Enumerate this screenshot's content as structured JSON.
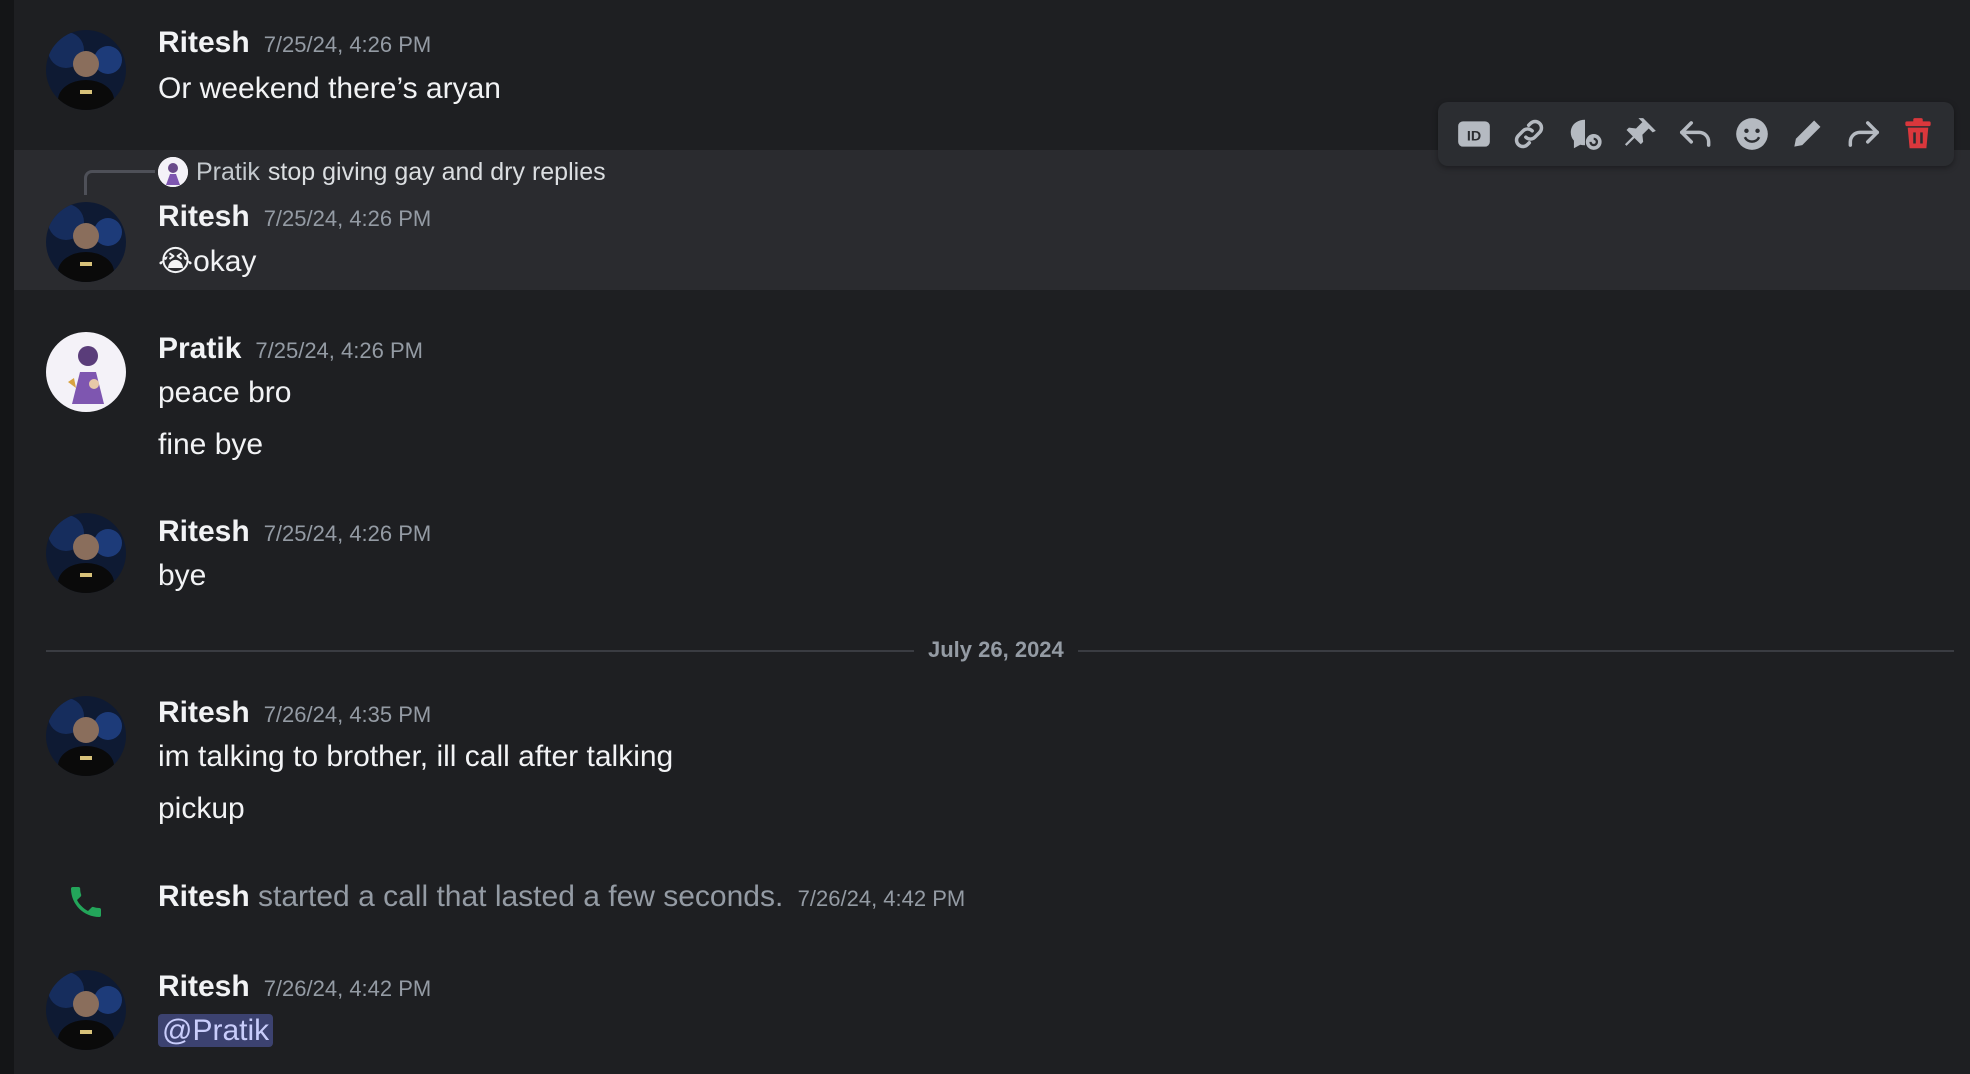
{
  "toolbar": {
    "actions": [
      {
        "icon": "id-icon",
        "label": "Copy ID"
      },
      {
        "icon": "link-icon",
        "label": "Copy Message Link"
      },
      {
        "icon": "thread-icon",
        "label": "Create Thread"
      },
      {
        "icon": "pin-icon",
        "label": "Pin Message"
      },
      {
        "icon": "reply-icon",
        "label": "Reply"
      },
      {
        "icon": "emoji-icon",
        "label": "Add Reaction"
      },
      {
        "icon": "edit-icon",
        "label": "Edit"
      },
      {
        "icon": "forward-icon",
        "label": "Forward"
      },
      {
        "icon": "delete-icon",
        "label": "Delete"
      }
    ],
    "delete_color": "#da373c",
    "icon_color": "#b5bac1"
  },
  "messages": [
    {
      "author": "Ritesh",
      "timestamp": "7/25/24, 4:26 PM",
      "lines": [
        "Or weekend there’s aryan"
      ]
    },
    {
      "author": "Ritesh",
      "timestamp": "7/25/24, 4:26 PM",
      "reply_to": {
        "author": "Pratik",
        "text": "stop giving gay and dry replies"
      },
      "emoji": "😭",
      "lines": [
        "okay"
      ]
    },
    {
      "author": "Pratik",
      "timestamp": "7/25/24, 4:26 PM",
      "lines": [
        "peace bro",
        "fine bye"
      ]
    },
    {
      "author": "Ritesh",
      "timestamp": "7/25/24, 4:26 PM",
      "lines": [
        "bye"
      ]
    },
    {
      "author": "Ritesh",
      "timestamp": "7/26/24, 4:35 PM",
      "lines": [
        "im talking to brother, ill call after talking",
        "pickup"
      ]
    },
    {
      "author": "Ritesh",
      "timestamp": "7/26/24, 4:42 PM",
      "mention": "@Pratik"
    }
  ],
  "date_divider": "July 26, 2024",
  "call": {
    "author": "Ritesh",
    "text": "started a call that lasted a few seconds.",
    "timestamp": "7/26/24, 4:42 PM",
    "icon_color": "#23a55a"
  }
}
